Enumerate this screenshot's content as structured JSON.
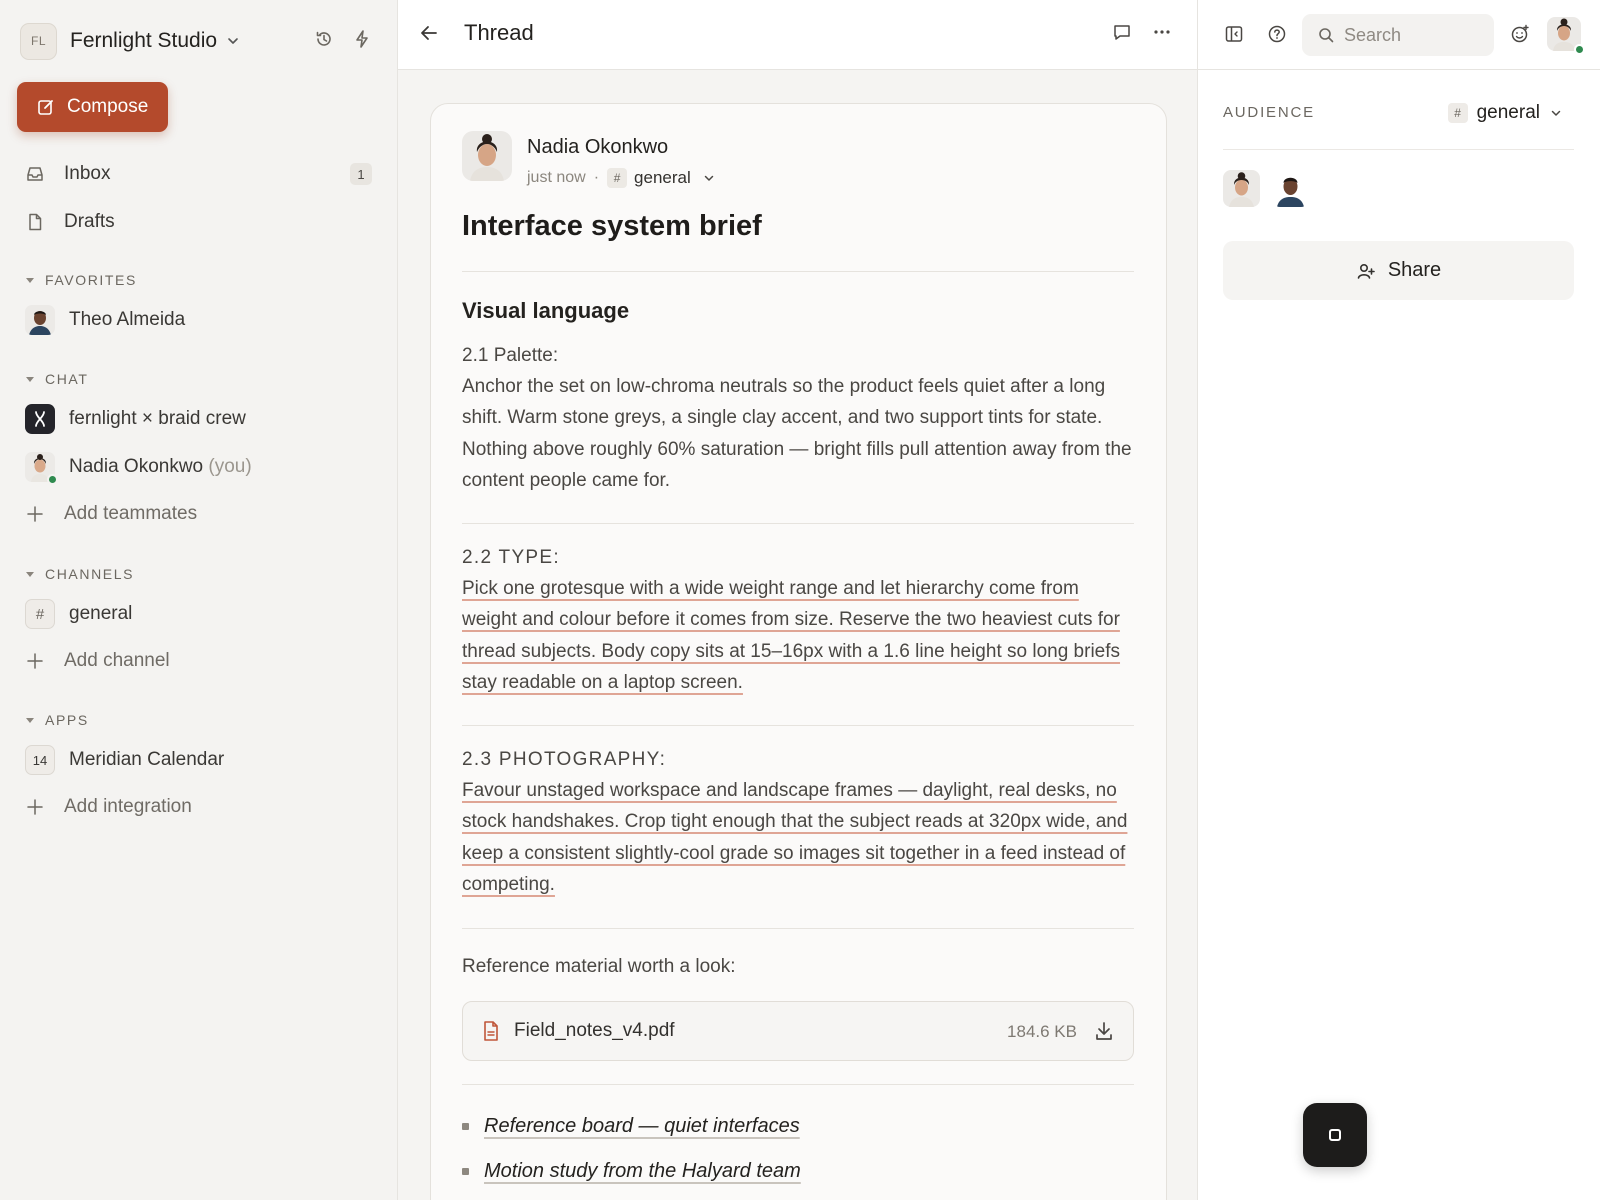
{
  "workspace": {
    "initials": "FL",
    "name": "Fernlight Studio"
  },
  "sidebar": {
    "compose_label": "Compose",
    "nav": [
      {
        "label": "Inbox",
        "badge": "1"
      },
      {
        "label": "Drafts"
      }
    ],
    "favorites": {
      "title": "FAVORITES",
      "items": [
        {
          "label": "Theo Almeida"
        }
      ]
    },
    "chat": {
      "title": "CHAT",
      "items": [
        {
          "label": "fernlight × braid crew"
        },
        {
          "label": "Nadia Okonkwo",
          "suffix": "(you)"
        }
      ],
      "add_label": "Add teammates"
    },
    "channels": {
      "title": "CHANNELS",
      "items": [
        {
          "label": "general",
          "icon": "#"
        }
      ],
      "add_label": "Add channel"
    },
    "apps": {
      "title": "APPS",
      "items": [
        {
          "label": "Meridian Calendar",
          "icon_text": "14"
        }
      ],
      "add_label": "Add integration"
    }
  },
  "thread": {
    "header_title": "Thread",
    "author": "Nadia Okonkwo",
    "time": "just now",
    "channel_hash": "#",
    "channel": "general",
    "subject": "Interface system brief",
    "section_heading": "Visual language",
    "blocks": [
      {
        "caption": "2.1 Palette:",
        "text": "Anchor the set on low-chroma neutrals so the product feels quiet after a long shift. Warm stone greys, a single clay accent, and two support tints for state. Nothing above roughly 60% saturation — bright fills pull attention away from the content people came for."
      },
      {
        "caption": "2.2 TYPE:",
        "text": "Pick one grotesque with a wide weight range and let hierarchy come from weight and colour before it comes from size. Reserve the two heaviest cuts for thread subjects. Body copy sits at 15–16px with a 1.6 line height so long briefs stay readable on a laptop screen."
      },
      {
        "caption": "2.3 PHOTOGRAPHY:",
        "text": "Favour unstaged workspace and landscape frames — daylight, real desks, no stock handshakes. Crop tight enough that the subject reads at 320px wide, and keep a consistent slightly-cool grade so images sit together in a feed instead of competing."
      }
    ],
    "reference_label": "Reference material worth a look:",
    "attachment": {
      "name": "Field_notes_v4.pdf",
      "size": "184.6 KB"
    },
    "links": [
      "Reference board — quiet interfaces",
      "Motion study from the Halyard team"
    ]
  },
  "right_panel": {
    "search_placeholder": "Search",
    "audience_label": "AUDIENCE",
    "audience_hash": "#",
    "audience_channel": "general",
    "share_label": "Share"
  },
  "colors": {
    "accent": "#b44a2c",
    "underline": "#dfa595",
    "online": "#2f8a4f"
  }
}
